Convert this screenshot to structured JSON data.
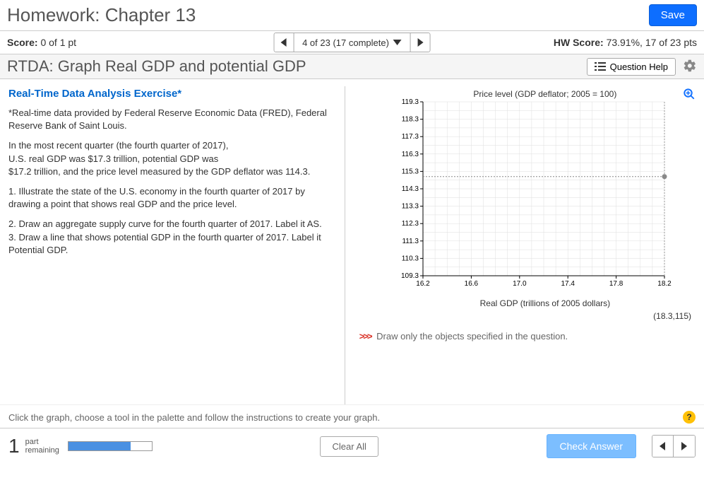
{
  "header": {
    "title": "Homework: Chapter 13",
    "save": "Save"
  },
  "score": {
    "label": "Score:",
    "value": "0 of 1 pt",
    "nav_label": "4 of 23 (17 complete)",
    "hw_label": "HW Score:",
    "hw_value": "73.91%, 17 of 23 pts"
  },
  "question": {
    "title": "RTDA: Graph Real GDP and potential GDP",
    "help": "Question Help"
  },
  "exercise": {
    "heading": "Real-Time Data Analysis Exercise*",
    "source": "*Real-time data provided by Federal Reserve Economic Data (FRED), Federal Reserve Bank of Saint Louis.",
    "p1": "In the most recent quarter (the fourth quarter of 2017),",
    "p2": "U.S. real GDP was $17.3 trillion, potential GDP was",
    "p3": "$17.2 trillion, and the price level measured by the GDP deflator was 114.3.",
    "q1": "1. Illustrate the state of the U.S. economy in the fourth quarter of 2017 by drawing a point that shows real GDP and the price level.",
    "q2": "2. Draw an aggregate supply curve for the fourth quarter of 2017. Label it AS.",
    "q3": "3. Draw a line that shows potential GDP in the fourth quarter of 2017. Label it Potential GDP."
  },
  "chart_data": {
    "type": "scatter",
    "title": "Price level (GDP deflator; 2005 = 100)",
    "xlabel": "Real GDP (trillions of 2005 dollars)",
    "xlim": [
      16.2,
      18.2
    ],
    "ylim": [
      109.3,
      119.3
    ],
    "xticks": [
      16.2,
      16.6,
      17.0,
      17.4,
      17.8,
      18.2
    ],
    "yticks": [
      109.3,
      110.3,
      111.3,
      112.3,
      113.3,
      114.3,
      115.3,
      116.3,
      117.3,
      118.3,
      119.3
    ],
    "cursor_point": {
      "x": 18.3,
      "y": 115
    },
    "cursor_label": "(18.3,115)",
    "guide_y": 115
  },
  "instruction": {
    "arrows": ">>>",
    "text": "Draw only the objects specified in the question."
  },
  "hint": "Click the graph, choose a tool in the palette and follow the instructions to create your graph.",
  "footer": {
    "part_num": "1",
    "part_label_1": "part",
    "part_label_2": "remaining",
    "progress_pct": 75,
    "clear": "Clear All",
    "check": "Check Answer"
  }
}
